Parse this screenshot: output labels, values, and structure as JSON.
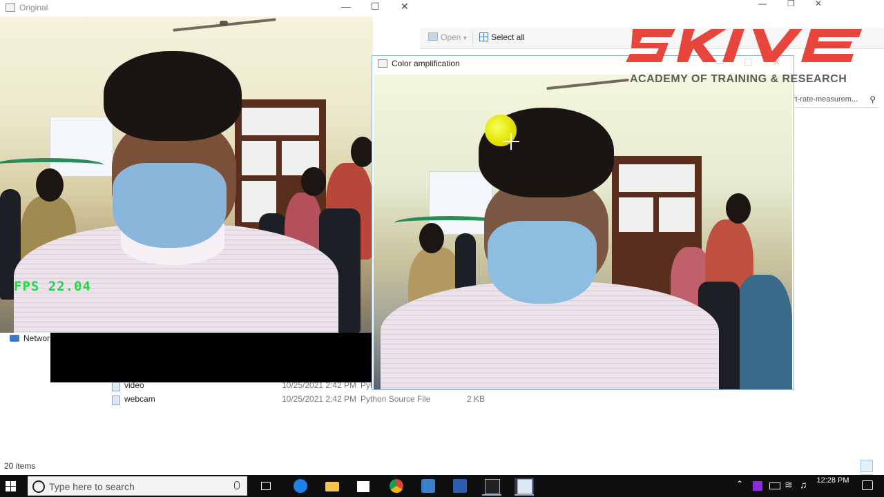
{
  "explorer": {
    "ribbon": {
      "open_label": "Open",
      "open_caret": "▾",
      "select_all_label": "Select all"
    },
    "search_text": "rt-rate-measurem...",
    "nav_network": "Networ",
    "files": [
      {
        "name": "video",
        "date": "10/25/2021 2:42 PM",
        "type": "Pyt",
        "size": ""
      },
      {
        "name": "webcam",
        "date": "10/25/2021 2:42 PM",
        "type": "Python Source File",
        "size": "2 KB"
      }
    ],
    "status_count": "20 items",
    "window_controls": [
      "—",
      "❐",
      "✕"
    ]
  },
  "original_window": {
    "title": "Original",
    "controls": [
      "—",
      "☐",
      "✕"
    ],
    "fps_text": "FPS 22.04"
  },
  "amplification_window": {
    "title": "Color amplification",
    "controls": [
      "—",
      "☐",
      "✕"
    ]
  },
  "watermark": {
    "brand": "SKIVE",
    "tagline": "ACADEMY OF TRAINING & RESEARCH",
    "color": "#e8453c"
  },
  "taskbar": {
    "search_placeholder": "Type here to search",
    "apps": [
      "task-view-icon",
      "edge-icon",
      "file-explorer-icon",
      "store-icon",
      "chrome-icon",
      "camera-app-icon",
      "word-icon",
      "terminal-icon",
      "python-window-icon"
    ],
    "clock_time": "12:28 PM",
    "tray_icons": [
      "chevron-up-icon",
      "app-tray-icon",
      "battery-icon",
      "wifi-icon",
      "volume-icon"
    ]
  },
  "colors": {
    "fps_green": "#22d64a",
    "taskbar_bg": "#0f0f12",
    "window_border_active": "#8cb4dc",
    "cursor_highlight": "#e2e100"
  }
}
